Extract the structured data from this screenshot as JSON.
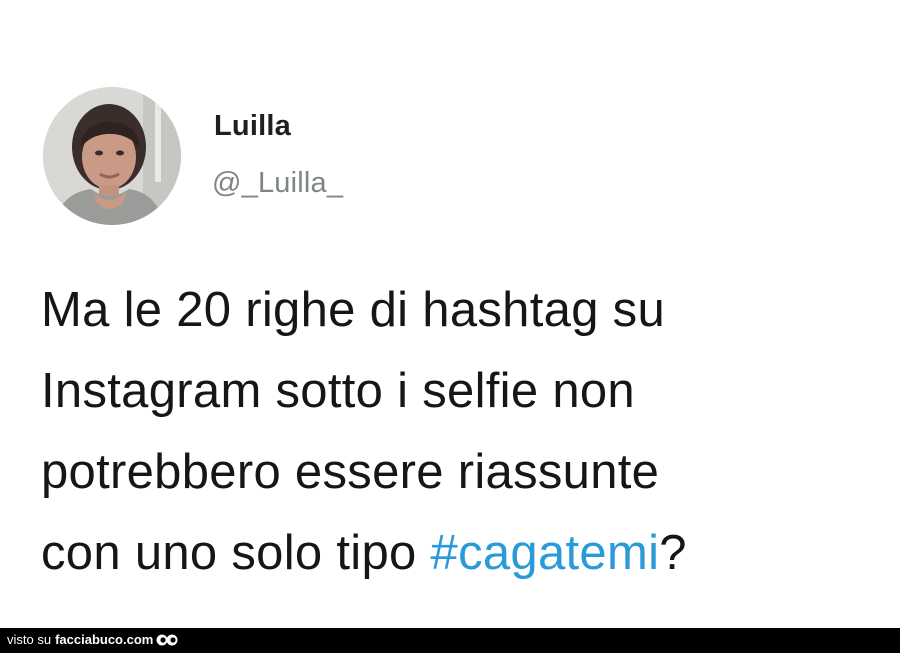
{
  "tweet": {
    "author": {
      "display_name": "Luilla",
      "handle": "@_Luilla_",
      "avatar_icon": "user-avatar-photo"
    },
    "text_lines": [
      "Ma le 20 righe di hashtag su",
      "Instagram sotto i selfie non",
      "potrebbero essere riassunte",
      "con uno solo tipo "
    ],
    "hashtag": "#cagatemi",
    "trailing_text": "?"
  },
  "watermark": {
    "prefix": "visto su",
    "brand": "facciabuco.com",
    "logo_icon": "eyes-icon"
  },
  "colors": {
    "hashtag": "#2a9ad8",
    "display_name": "#1f1f1f",
    "handle": "#7f8487",
    "text": "#161616",
    "footer_background": "#000000"
  }
}
